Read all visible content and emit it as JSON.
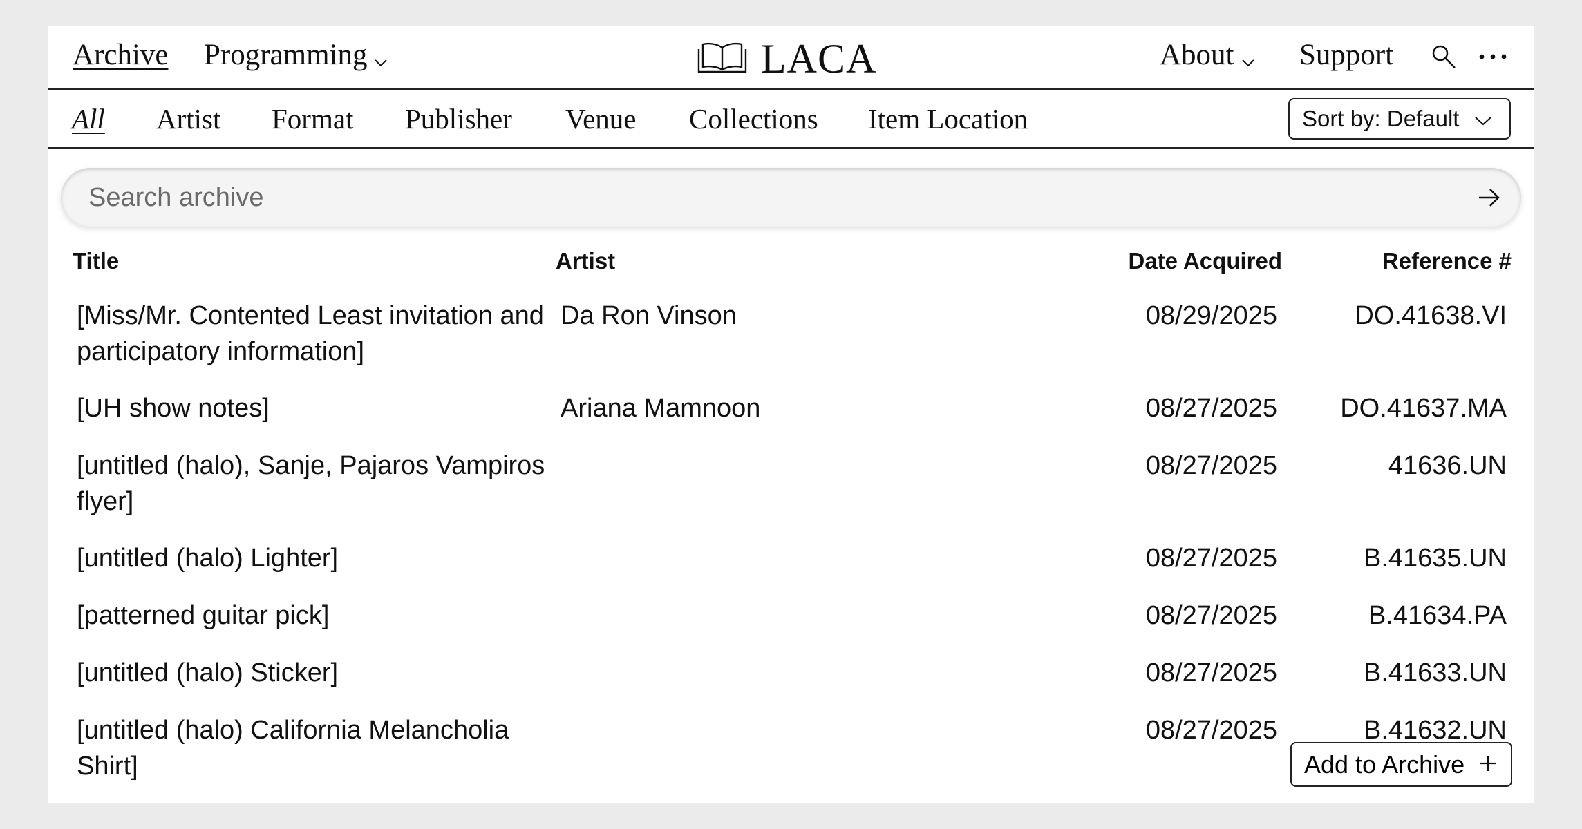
{
  "topnav": {
    "archive_label": "Archive",
    "programming_label": "Programming",
    "logo_text": "LACA",
    "about_label": "About",
    "support_label": "Support",
    "icons": [
      "book-icon",
      "search-icon",
      "more-icon",
      "chevron-down-icon"
    ]
  },
  "filters": {
    "items": [
      "All",
      "Artist",
      "Format",
      "Publisher",
      "Venue",
      "Collections",
      "Item Location"
    ],
    "active": "All"
  },
  "sort": {
    "label": "Sort by: Default"
  },
  "search": {
    "placeholder": "Search archive",
    "value": ""
  },
  "table": {
    "headers": {
      "title": "Title",
      "artist": "Artist",
      "date": "Date Acquired",
      "ref": "Reference #"
    },
    "rows": [
      {
        "title": "[Miss/Mr. Contented Least invitation and participatory information]",
        "artist": "Da Ron Vinson",
        "date": "08/29/2025",
        "ref": "DO.41638.VI"
      },
      {
        "title": "[UH show notes]",
        "artist": "Ariana Mamnoon",
        "date": "08/27/2025",
        "ref": "DO.41637.MA"
      },
      {
        "title": "[untitled (halo), Sanje, Pajaros Vampiros flyer]",
        "artist": "",
        "date": "08/27/2025",
        "ref": "41636.UN"
      },
      {
        "title": "[untitled (halo) Lighter]",
        "artist": "",
        "date": "08/27/2025",
        "ref": "B.41635.UN"
      },
      {
        "title": "[patterned guitar pick]",
        "artist": "",
        "date": "08/27/2025",
        "ref": "B.41634.PA"
      },
      {
        "title": "[untitled (halo) Sticker]",
        "artist": "",
        "date": "08/27/2025",
        "ref": "B.41633.UN"
      },
      {
        "title": "[untitled (halo) California Melancholia Shirt]",
        "artist": "",
        "date": "08/27/2025",
        "ref": "B.41632.UN"
      }
    ]
  },
  "add_button": {
    "label": "Add to Archive"
  }
}
